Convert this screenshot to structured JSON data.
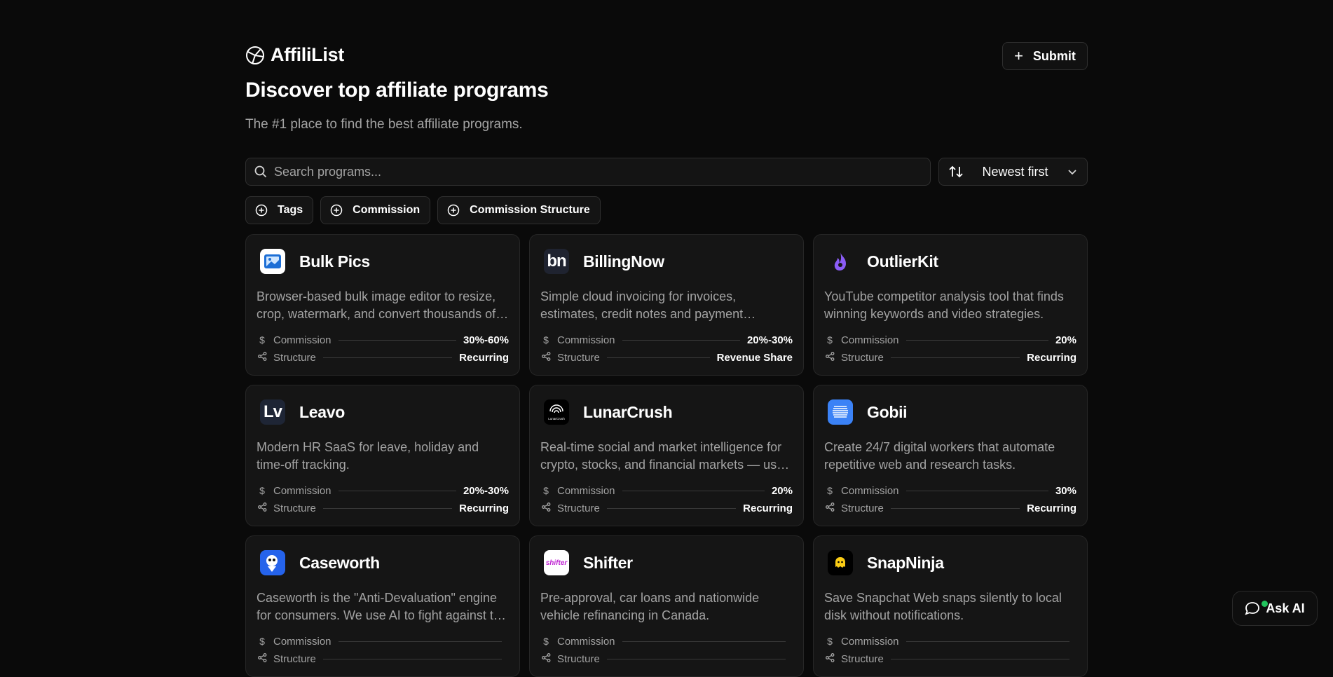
{
  "header": {
    "logo_text": "AffiliList",
    "submit_label": "Submit"
  },
  "hero": {
    "title": "Discover top affiliate programs",
    "subtitle": "The #1 place to find the best affiliate programs."
  },
  "search": {
    "placeholder": "Search programs..."
  },
  "sort": {
    "selected": "Newest first"
  },
  "filters": [
    {
      "label": "Tags"
    },
    {
      "label": "Commission"
    },
    {
      "label": "Commission Structure"
    }
  ],
  "meta_labels": {
    "commission": "Commission",
    "structure": "Structure"
  },
  "programs": [
    {
      "name": "Bulk Pics",
      "description": "Browser-based bulk image editor to resize, crop, watermark, and convert thousands of images at once.",
      "commission": "30%-60%",
      "structure": "Recurring",
      "logo_text": "",
      "logo_bg": "#ffffff",
      "logo_fg": "#1d6fd6",
      "logo_kind": "image"
    },
    {
      "name": "BillingNow",
      "description": "Simple cloud invoicing for invoices, estimates, credit notes and payment tracking.",
      "commission": "20%-30%",
      "structure": "Revenue Share",
      "logo_text": "bn",
      "logo_bg": "#1f2330",
      "logo_fg": "#ffffff",
      "logo_kind": "text"
    },
    {
      "name": "OutlierKit",
      "description": "YouTube competitor analysis tool that finds winning keywords and video strategies.",
      "commission": "20%",
      "structure": "Recurring",
      "logo_text": "",
      "logo_bg": "transparent",
      "logo_fg": "#8b5cf6",
      "logo_kind": "flame"
    },
    {
      "name": "Leavo",
      "description": "Modern HR SaaS for leave, holiday and time-off tracking.",
      "commission": "20%-30%",
      "structure": "Recurring",
      "logo_text": "Lv",
      "logo_bg": "#1e2535",
      "logo_fg": "#ffffff",
      "logo_kind": "text"
    },
    {
      "name": "LunarCrush",
      "description": "Real-time social and market intelligence for crypto, stocks, and financial markets — used by traders worldwide.",
      "commission": "20%",
      "structure": "Recurring",
      "logo_text": "",
      "logo_bg": "#000000",
      "logo_fg": "#ffffff",
      "logo_kind": "lunar"
    },
    {
      "name": "Gobii",
      "description": "Create 24/7 digital workers that automate repetitive web and research tasks.",
      "commission": "30%",
      "structure": "Recurring",
      "logo_text": "",
      "logo_bg": "#3b82f6",
      "logo_fg": "#ffffff",
      "logo_kind": "lines"
    },
    {
      "name": "Caseworth",
      "description": "Caseworth is the \"Anti-Devaluation\" engine for consumers. We use AI to fight against the insurance companies.",
      "commission": "",
      "structure": "",
      "logo_text": "",
      "logo_bg": "#2563eb",
      "logo_fg": "#ffffff",
      "logo_kind": "mascot"
    },
    {
      "name": "Shifter",
      "description": "Pre-approval, car loans and nationwide vehicle refinancing in Canada.",
      "commission": "",
      "structure": "",
      "logo_text": "shifter",
      "logo_bg": "#ffffff",
      "logo_fg": "#c026d3",
      "logo_kind": "text-small"
    },
    {
      "name": "SnapNinja",
      "description": "Save Snapchat Web snaps silently to local disk without notifications.",
      "commission": "",
      "structure": "",
      "logo_text": "",
      "logo_bg": "#000000",
      "logo_fg": "#facc15",
      "logo_kind": "ghost"
    }
  ],
  "ask_ai": {
    "label": "Ask AI"
  },
  "colors": {
    "background": "#0a0a0a",
    "card": "#151515",
    "border": "#262626",
    "muted_text": "#a3a3a3",
    "online_dot": "#22c55e"
  }
}
